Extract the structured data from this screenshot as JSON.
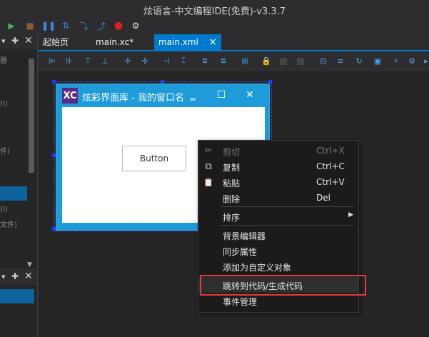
{
  "app": {
    "title": "炫语言-中文编程IDE(免费)-v3.3.7"
  },
  "tabs": [
    {
      "label": "起始页",
      "active": false
    },
    {
      "label": "main.xc*",
      "active": false
    },
    {
      "label": "main.xml",
      "active": true
    }
  ],
  "tab_close_icon": "×",
  "left_panel": {
    "texts": [
      "器",
      "(l)",
      "件)",
      "(l)",
      "文件)"
    ]
  },
  "designer": {
    "window_caption": "炫彩界面库 - 我的窗口名",
    "logo_text": "XC",
    "button_label": "Button",
    "window_bg": "#1e9cd9"
  },
  "context_menu": {
    "items": [
      {
        "label": "剪切",
        "shortcut": "Ctrl+X",
        "icon": "scissors-icon",
        "glyph": "✂",
        "disabled": true
      },
      {
        "label": "复制",
        "shortcut": "Ctrl+C",
        "icon": "copy-icon",
        "glyph": "⧉",
        "disabled": false
      },
      {
        "label": "粘贴",
        "shortcut": "Ctrl+V",
        "icon": "paste-icon",
        "glyph": "📋",
        "disabled": false
      },
      {
        "label": "删除",
        "shortcut": "Del",
        "icon": "",
        "glyph": "",
        "disabled": false
      },
      {
        "label": "排序",
        "shortcut": "",
        "submenu": true
      },
      {
        "label": "背景编辑器",
        "shortcut": ""
      },
      {
        "label": "同步属性",
        "shortcut": ""
      },
      {
        "label": "添加为自定义对象",
        "shortcut": ""
      },
      {
        "label": "跳转到代码/生成代码",
        "shortcut": "",
        "highlighted": true
      },
      {
        "label": "事件管理",
        "shortcut": ""
      }
    ]
  },
  "colors": {
    "accent": "#007acc",
    "highlight_box": "#e43b3b"
  }
}
